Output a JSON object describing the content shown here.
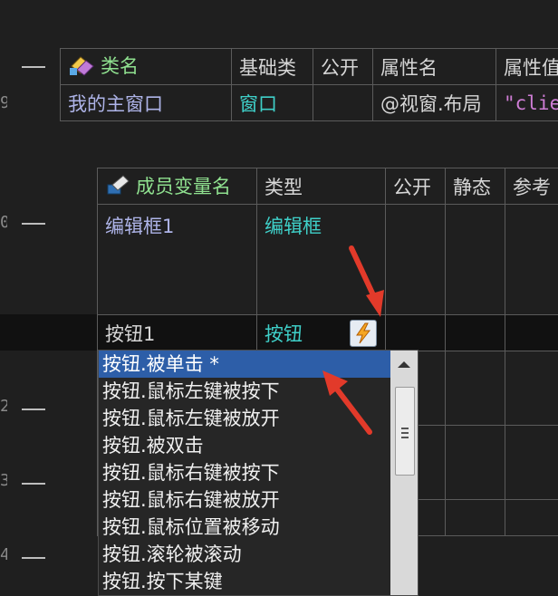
{
  "gutter": {
    "lines": [
      "9",
      "0",
      "1",
      "2",
      "3",
      "4"
    ]
  },
  "class_table": {
    "headers": [
      "类名",
      "基础类",
      "公开",
      "属性名",
      "属性值"
    ],
    "row": {
      "class_name": "我的主窗口",
      "base_class": "窗口",
      "public": "",
      "property_name": "@视窗.布局",
      "property_value": "\"clie"
    }
  },
  "member_table": {
    "headers": [
      "成员变量名",
      "类型",
      "公开",
      "静态",
      "参考"
    ],
    "rows": [
      {
        "name": "编辑框1",
        "type": "编辑框"
      },
      {
        "name": "按钮1",
        "type": "按钮"
      }
    ]
  },
  "event_popup": {
    "items": [
      "按钮.被单击 *",
      "按钮.鼠标左键被按下",
      "按钮.鼠标左键被放开",
      "按钮.被双击",
      "按钮.鼠标右键被按下",
      "按钮.鼠标右键被放开",
      "按钮.鼠标位置被移动",
      "按钮.滚轮被滚动",
      "按钮.按下某键"
    ],
    "selected_index": 0
  },
  "colors": {
    "background": "#1f1f1f",
    "selection": "#2d5ea8",
    "annotation_arrow": "#e23a2a",
    "class_name_green": "#8fe08f",
    "type_cyan": "#3fd0c9"
  }
}
